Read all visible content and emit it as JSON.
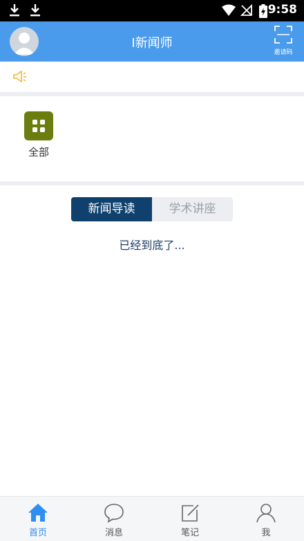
{
  "status_bar": {
    "time": "9:58"
  },
  "header": {
    "title": "I新闻师",
    "scan_label": "邀请码"
  },
  "categories": [
    {
      "label": "全部"
    }
  ],
  "tabs": [
    {
      "label": "新闻导读",
      "active": true
    },
    {
      "label": "学术讲座",
      "active": false
    }
  ],
  "list_end_text": "已经到底了...",
  "bottom_nav": [
    {
      "label": "首页",
      "icon": "home-icon",
      "active": true
    },
    {
      "label": "消息",
      "icon": "chat-bubble-icon",
      "active": false
    },
    {
      "label": "笔记",
      "icon": "edit-note-icon",
      "active": false
    },
    {
      "label": "我",
      "icon": "person-icon",
      "active": false
    }
  ],
  "colors": {
    "header": "#4a9bec",
    "tab_active": "#10416e",
    "nav_active": "#2f8ef0",
    "category_icon": "#6b7d0e",
    "notice_icon": "#f0b429"
  }
}
